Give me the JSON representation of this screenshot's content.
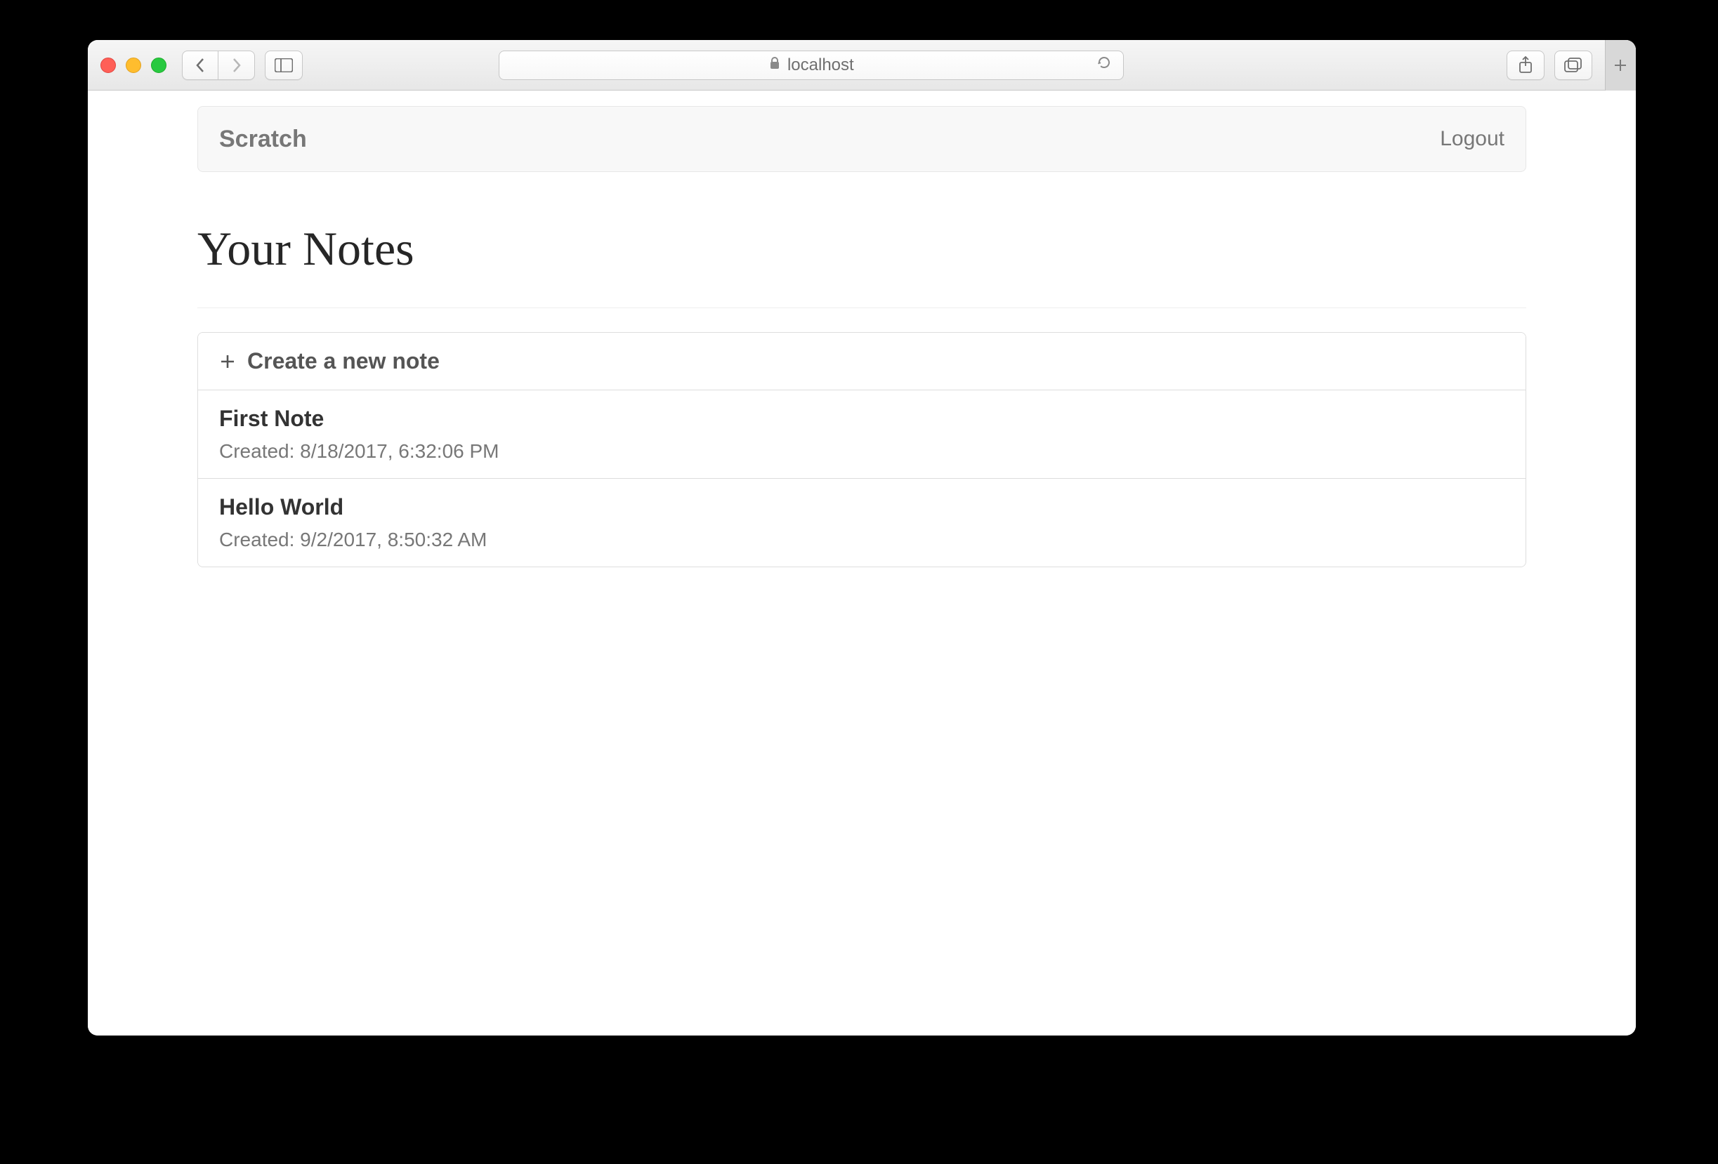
{
  "browser": {
    "url_host": "localhost"
  },
  "navbar": {
    "brand": "Scratch",
    "logout": "Logout"
  },
  "page": {
    "title": "Your Notes",
    "create_label": "Create a new note",
    "notes": [
      {
        "title": "First Note",
        "meta": "Created: 8/18/2017, 6:32:06 PM"
      },
      {
        "title": "Hello World",
        "meta": "Created: 9/2/2017, 8:50:32 AM"
      }
    ]
  }
}
